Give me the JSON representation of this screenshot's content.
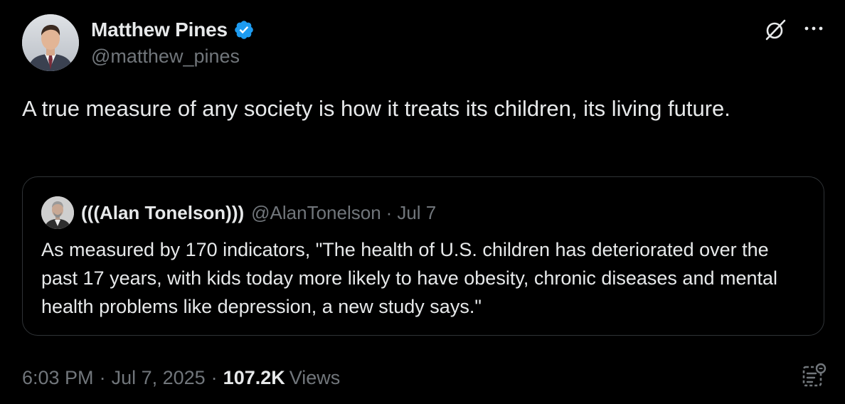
{
  "author": {
    "name": "Matthew Pines",
    "handle": "@matthew_pines",
    "verified": true
  },
  "tweet": {
    "text": "A true measure of any society is how it treats its children, its living future."
  },
  "quote": {
    "name": "(((Alan Tonelson)))",
    "handle": "@AlanTonelson",
    "separator": "·",
    "date": "Jul 7",
    "text": "As measured by 170 indicators, \"The health of U.S. children has deteriorated over the past 17 years, with kids today more likely to have obesity, chronic diseases and mental health problems like depression, a new study says.\""
  },
  "meta": {
    "time": "6:03 PM",
    "separator": "·",
    "date": "Jul 7, 2025",
    "views_count": "107.2K",
    "views_label": "Views"
  },
  "icons": {
    "verified": "verified-badge-icon",
    "grok": "grok-icon",
    "more": "more-icon",
    "community_note": "community-note-icon"
  },
  "colors": {
    "background": "#000000",
    "text_primary": "#e7e9ea",
    "text_secondary": "#71767b",
    "border": "#2f3336",
    "verified_blue": "#1d9bf0"
  }
}
